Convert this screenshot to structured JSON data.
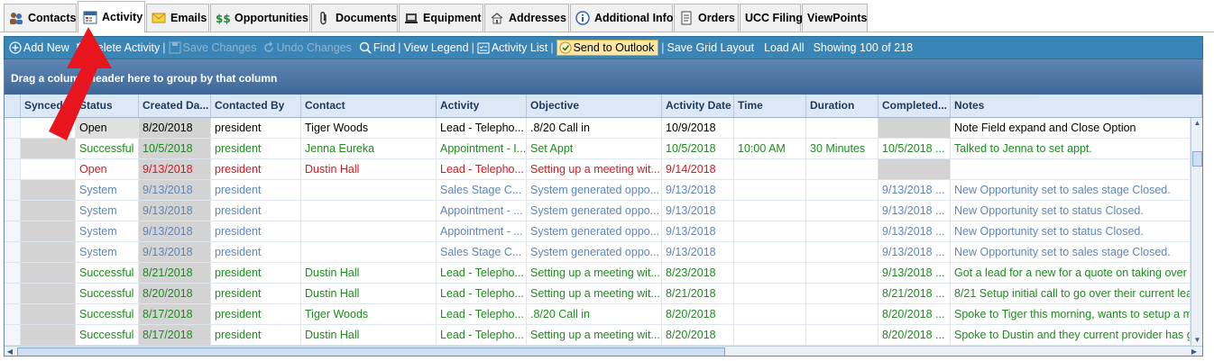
{
  "tabs": [
    {
      "label": "Contacts",
      "icon": "contacts-icon"
    },
    {
      "label": "Activity",
      "icon": "activity-icon",
      "active": true
    },
    {
      "label": "Emails",
      "icon": "email-icon"
    },
    {
      "label": "Opportunities",
      "icon": "dollar-icon"
    },
    {
      "label": "Documents",
      "icon": "paperclip-icon"
    },
    {
      "label": "Equipment",
      "icon": "equipment-icon"
    },
    {
      "label": "Addresses",
      "icon": "address-icon"
    },
    {
      "label": "Additional Info",
      "icon": "info-icon"
    },
    {
      "label": "Orders",
      "icon": "orders-icon"
    },
    {
      "label": "UCC Filing",
      "icon": ""
    },
    {
      "label": "ViewPoints",
      "icon": ""
    }
  ],
  "toolbar": {
    "add_new": "Add New",
    "delete_activity": "Delete Activity",
    "save_changes": "Save Changes",
    "undo_changes": "Undo Changes",
    "find": "Find",
    "view_legend": "View Legend",
    "activity_list": "Activity List",
    "send_to_outlook": "Send to Outlook",
    "save_grid_layout": "Save Grid Layout",
    "load_all": "Load All",
    "showing": "Showing 100 of 218"
  },
  "grid": {
    "group_hint": "Drag a column header here to group by that column",
    "columns": [
      "Synced",
      "Status",
      "Created Da...",
      "Contacted By",
      "Contact",
      "Activity",
      "Objective",
      "Activity Date",
      "Time",
      "Duration",
      "Completed...",
      "Notes"
    ],
    "rows": [
      {
        "style": "open",
        "synced": "",
        "status": "Open",
        "created": "8/20/2018",
        "by": "president",
        "contact": "Tiger Woods",
        "activity": "Lead - Telepho...",
        "objective": ".8/20 Call in",
        "date": "10/9/2018",
        "time": "",
        "duration": "",
        "completed": "",
        "notes": "Note Field expand and Close Option"
      },
      {
        "style": "succ",
        "synced": "",
        "status": "Successful",
        "created": "10/5/2018",
        "by": "president",
        "contact": "Jenna Eureka",
        "activity": "Appointment - I...",
        "objective": "Set Appt",
        "date": "10/5/2018",
        "time": "10:00 AM",
        "duration": "30 Minutes",
        "completed": "10/5/2018 ...",
        "notes": "Talked to Jenna to set appt."
      },
      {
        "style": "red",
        "synced": "",
        "status": "Open",
        "created": "9/13/2018",
        "by": "president",
        "contact": "Dustin Hall",
        "activity": "Lead - Telepho...",
        "objective": "Setting up a meeting wit...",
        "date": "9/14/2018",
        "time": "",
        "duration": "",
        "completed": "",
        "notes": ""
      },
      {
        "style": "sys",
        "synced": "",
        "status": "System",
        "created": "9/13/2018",
        "by": "president",
        "contact": "",
        "activity": "Sales Stage C...",
        "objective": "System generated oppo...",
        "date": "9/13/2018",
        "time": "",
        "duration": "",
        "completed": "9/13/2018 ...",
        "notes": "New Opportunity set to sales stage Closed."
      },
      {
        "style": "sys",
        "synced": "",
        "status": "System",
        "created": "9/13/2018",
        "by": "president",
        "contact": "",
        "activity": "Appointment - ...",
        "objective": "System generated oppo...",
        "date": "9/13/2018",
        "time": "",
        "duration": "",
        "completed": "9/13/2018 ...",
        "notes": "New Opportunity set to status Closed."
      },
      {
        "style": "sys",
        "synced": "",
        "status": "System",
        "created": "9/13/2018",
        "by": "president",
        "contact": "",
        "activity": "Appointment - ...",
        "objective": "System generated oppo...",
        "date": "9/13/2018",
        "time": "",
        "duration": "",
        "completed": "9/13/2018 ...",
        "notes": "New Opportunity set to status Closed."
      },
      {
        "style": "sys",
        "synced": "",
        "status": "System",
        "created": "9/13/2018",
        "by": "president",
        "contact": "",
        "activity": "Sales Stage C...",
        "objective": "System generated oppo...",
        "date": "9/13/2018",
        "time": "",
        "duration": "",
        "completed": "9/13/2018 ...",
        "notes": "New Opportunity set to sales stage Closed."
      },
      {
        "style": "succ",
        "synced": "",
        "status": "Successful",
        "created": "8/21/2018",
        "by": "president",
        "contact": "Dustin Hall",
        "activity": "Lead - Telepho...",
        "objective": "Setting up a meeting wit...",
        "date": "8/23/2018",
        "time": "",
        "duration": "",
        "completed": "9/13/2018 ...",
        "notes": "Got a lead for a new for a quote on taking over th"
      },
      {
        "style": "succ",
        "synced": "",
        "status": "Successful",
        "created": "8/20/2018",
        "by": "president",
        "contact": "Dustin Hall",
        "activity": "Lead - Telepho...",
        "objective": "Setting up a meeting wit...",
        "date": "8/21/2018",
        "time": "",
        "duration": "",
        "completed": "8/21/2018 ...",
        "notes": "8/21 Setup initial call to go over their current lea"
      },
      {
        "style": "succ",
        "synced": "",
        "status": "Successful",
        "created": "8/17/2018",
        "by": "president",
        "contact": "Tiger Woods",
        "activity": "Lead - Telepho...",
        "objective": ".8/20 Call in",
        "date": "8/20/2018",
        "time": "",
        "duration": "",
        "completed": "8/20/2018 ...",
        "notes": "Spoke to Tiger this morning, wants to setup a m"
      },
      {
        "style": "succ",
        "synced": "",
        "status": "Successful",
        "created": "8/17/2018",
        "by": "president",
        "contact": "Dustin Hall",
        "activity": "Lead - Telepho...",
        "objective": "Setting up a meeting wit...",
        "date": "8/20/2018",
        "time": "",
        "duration": "",
        "completed": "8/20/2018 ...",
        "notes": "Spoke to Dustin and they current provider has g"
      }
    ]
  },
  "colors": {
    "toolbar_bg": "#3a85b8",
    "group_bar": "#4a73a3",
    "successful": "#1e8a1e",
    "open_overdue": "#e0141e",
    "system": "#5f86b8",
    "annotation_arrow": "#e8141e"
  }
}
